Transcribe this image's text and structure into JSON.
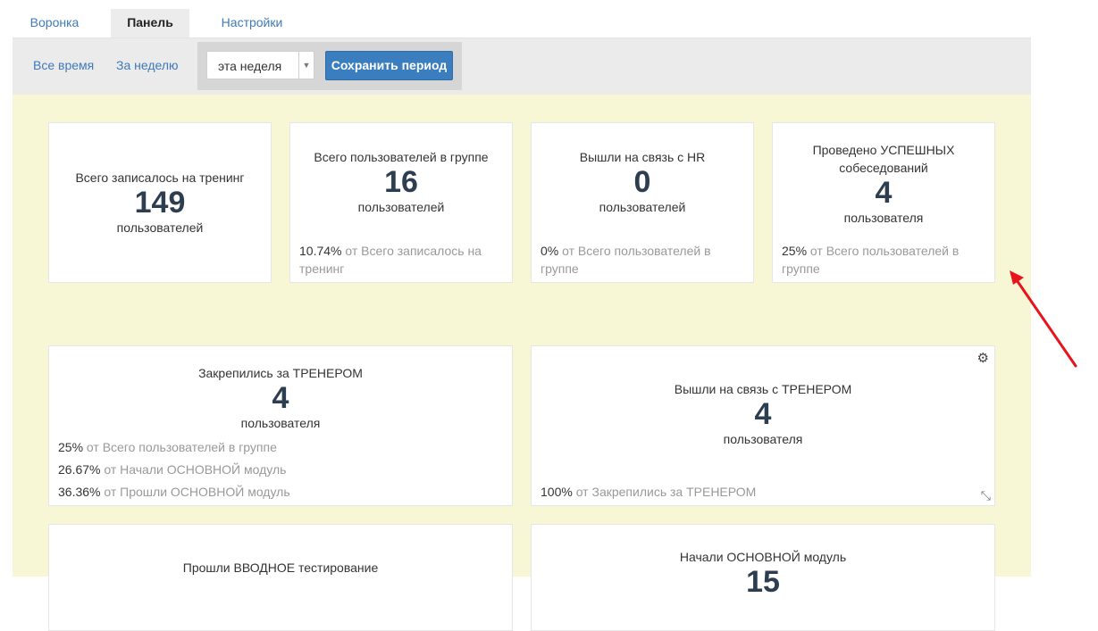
{
  "tabs": [
    {
      "label": "Воронка"
    },
    {
      "label": "Панель"
    },
    {
      "label": "Настройки"
    }
  ],
  "period": {
    "all_time": "Все время",
    "week": "За неделю",
    "select_value": "эта неделя",
    "save_label": "Сохранить период"
  },
  "cards": {
    "enrolled": {
      "title": "Всего записалось на тренинг",
      "value": "149",
      "unit": "пользователей"
    },
    "group_users": {
      "title": "Всего пользователей в группе",
      "value": "16",
      "unit": "пользователей",
      "foot_pct": "10.74%",
      "foot_text": " от Всего записалось на тренинг"
    },
    "hr_contact": {
      "title": "Вышли на связь с HR",
      "value": "0",
      "unit": "пользователей",
      "foot_pct": "0%",
      "foot_text": " от Всего пользователей в группе"
    },
    "interviews": {
      "title": "Проведено УСПЕШНЫХ собеседований",
      "value": "4",
      "unit": "пользователя",
      "foot_pct": "25%",
      "foot_text": " от Всего пользователей в группе"
    },
    "trainer_assigned": {
      "title": "Закрепились за ТРЕНЕРОМ",
      "value": "4",
      "unit": "пользователя",
      "foots": [
        {
          "pct": "25%",
          "text": " от Всего пользователей в группе"
        },
        {
          "pct": "26.67%",
          "text": " от Начали ОСНОВНОЙ модуль"
        },
        {
          "pct": "36.36%",
          "text": " от Прошли ОСНОВНОЙ модуль"
        }
      ]
    },
    "trainer_contact": {
      "title": "Вышли на связь с ТРЕНЕРОМ",
      "value": "4",
      "unit": "пользователя",
      "foot_pct": "100%",
      "foot_text": " от Закрепились за ТРЕНЕРОМ"
    },
    "intro_test": {
      "title": "Прошли ВВОДНОЕ тестирование"
    },
    "main_module": {
      "title": "Начали ОСНОВНОЙ модуль",
      "value": "15"
    }
  },
  "colors": {
    "accent": "#3a7ec0",
    "dashboard_bg": "#f7f7d6",
    "annotation_arrow": "#e8141c"
  },
  "icons": {
    "settings": "gear-icon",
    "resize": "resize-icon",
    "dropdown": "caret-down-icon"
  }
}
